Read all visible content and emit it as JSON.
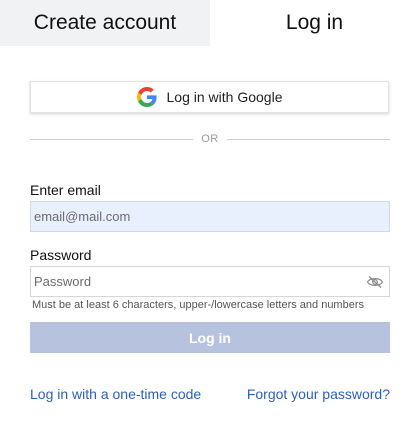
{
  "tabs": {
    "create_account": "Create account",
    "log_in": "Log in"
  },
  "google": {
    "label": "Log in with Google",
    "icon": "google-g-icon"
  },
  "divider": {
    "text": "OR"
  },
  "email": {
    "label": "Enter email",
    "value": "",
    "placeholder": "email@mail.com"
  },
  "password": {
    "label": "Password",
    "value": "",
    "placeholder": "Password",
    "toggle_icon": "eye-slash-icon",
    "hint": "Must be at least 6 characters, upper-/lowercase letters and numbers"
  },
  "submit": {
    "label": "Log in"
  },
  "links": {
    "one_time_code": "Log in with a one-time code",
    "forgot_password": "Forgot your password?"
  },
  "colors": {
    "submit_bg": "#b6c2de",
    "email_bg": "#e8f0fe",
    "link": "#2f5fb3",
    "inactive_tab_bg": "#f1f2f4"
  }
}
